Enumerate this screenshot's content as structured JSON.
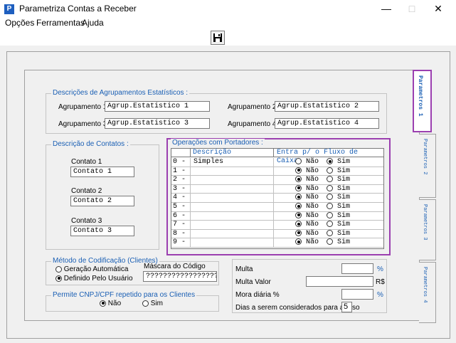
{
  "window": {
    "title": "Parametriza Contas a Receber",
    "icon_glyph": "P",
    "minimize_glyph": "—",
    "maximize_glyph": "□",
    "close_glyph": "✕"
  },
  "menu": [
    "Opções",
    "Ferramentas",
    "Ajuda"
  ],
  "toolbar": {
    "save_icon": "floppy-disk-icon"
  },
  "tabs": [
    "Parametros 1",
    "Parametros 2",
    "Parametros 3",
    "Parametros 4"
  ],
  "agrupamentos": {
    "legend": "Descrições de Agrupamentos Estatísticos :",
    "items": [
      {
        "label": "Agrupamento 1",
        "value": "Agrup.Estatistico 1"
      },
      {
        "label": "Agrupamento 2",
        "value": "Agrup.Estatistico 2"
      },
      {
        "label": "Agrupamento 3",
        "value": "Agrup.Estatistico 3"
      },
      {
        "label": "Agrupamento 4",
        "value": "Agrup.Estatistico 4"
      }
    ]
  },
  "contatos": {
    "legend": "Descrição de Contatos :",
    "items": [
      {
        "label": "Contato 1",
        "value": "Contato 1"
      },
      {
        "label": "Contato 2",
        "value": "Contato 2"
      },
      {
        "label": "Contato 3",
        "value": "Contato 3"
      }
    ]
  },
  "operacoes": {
    "legend": "Operações com Portadores :",
    "col_descricao": "Descrição",
    "col_fluxo": "Entra p/ o Fluxo de Caixa",
    "nao_label": "Não",
    "sim_label": "Sim",
    "rows": [
      {
        "num": "0 -",
        "desc": "Simples",
        "sim": true
      },
      {
        "num": "1 -",
        "desc": "",
        "sim": false
      },
      {
        "num": "2 -",
        "desc": "",
        "sim": false
      },
      {
        "num": "3 -",
        "desc": "",
        "sim": false
      },
      {
        "num": "4 -",
        "desc": "",
        "sim": false
      },
      {
        "num": "5 -",
        "desc": "",
        "sim": false
      },
      {
        "num": "6 -",
        "desc": "",
        "sim": false
      },
      {
        "num": "7 -",
        "desc": "",
        "sim": false
      },
      {
        "num": "8 -",
        "desc": "",
        "sim": false
      },
      {
        "num": "9 -",
        "desc": "",
        "sim": false
      }
    ]
  },
  "metodo": {
    "legend": "Método de Codificação (Clientes)",
    "opt_auto": "Geração Automática",
    "opt_usuario": "Definido Pelo Usuário",
    "selected": "usuario",
    "mascara_label": "Máscara do Código",
    "mascara_value": "?????????????????"
  },
  "cnpj": {
    "legend": "Permite CNPJ/CPF repetido para os Clientes",
    "opt_nao": "Não",
    "opt_sim": "Sim",
    "selected": "nao"
  },
  "multa": {
    "multa_label": "Multa",
    "multa_unit": "%",
    "multa_value": "",
    "multa_valor_label": "Multa Valor",
    "multa_valor_unit": "R$",
    "multa_valor_value": "",
    "mora_label": "Mora diária %",
    "mora_unit": "%",
    "mora_value": "",
    "dias_label": "Dias a serem considerados para atraso",
    "dias_value": "5"
  }
}
